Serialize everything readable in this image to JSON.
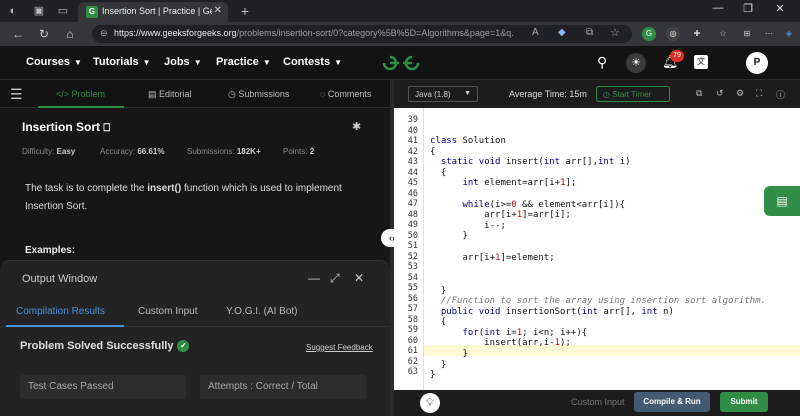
{
  "browser": {
    "tab_title": "Insertion Sort | Practice | GeeksforGeeks",
    "url_host": "https://www.geeksforgeeks.org",
    "url_path": "/problems/insertion-sort/0?category%5B%5D=Algorithms&page=1&q..."
  },
  "nav": {
    "items": [
      "Courses",
      "Tutorials",
      "Jobs",
      "Practice",
      "Contests"
    ],
    "notification_count": "79",
    "avatar_letter": "P"
  },
  "left_tabs": [
    "Problem",
    "Editorial",
    "Submissions",
    "Comments"
  ],
  "problem": {
    "title": "Insertion Sort",
    "difficulty_label": "Difficulty:",
    "difficulty": "Easy",
    "accuracy_label": "Accuracy:",
    "accuracy": "66.61%",
    "submissions_label": "Submissions:",
    "submissions": "182K+",
    "points_label": "Points:",
    "points": "2",
    "desc_pre": "The task is to complete the ",
    "desc_bold": "insert()",
    "desc_post": " function which is used to implement Insertion Sort.",
    "examples_label": "Examples:"
  },
  "output": {
    "title": "Output Window",
    "tabs": [
      "Compilation Results",
      "Custom Input",
      "Y.O.G.I. (AI Bot)"
    ],
    "status": "Problem Solved Successfully",
    "feedback": "Suggest Feedback",
    "test_cases": "Test Cases Passed",
    "attempts": "Attempts : Correct / Total"
  },
  "editor": {
    "language": "Java (1.8)",
    "avg_time": "Average Time: 15m",
    "timer": "Start Timer",
    "custom_input": "Custom Input",
    "compile": "Compile & Run",
    "submit": "Submit",
    "line_numbers": [
      "39",
      "40",
      "41",
      "42",
      "43",
      "44",
      "45",
      "46",
      "47",
      "48",
      "49",
      "50",
      "51",
      "52",
      "53",
      "54",
      "55",
      "56",
      "57",
      "58",
      "59",
      "60",
      "61",
      "62",
      "63"
    ]
  },
  "colors": {
    "brand_green": "#2f8d46",
    "accent_blue": "#4a90d9"
  }
}
